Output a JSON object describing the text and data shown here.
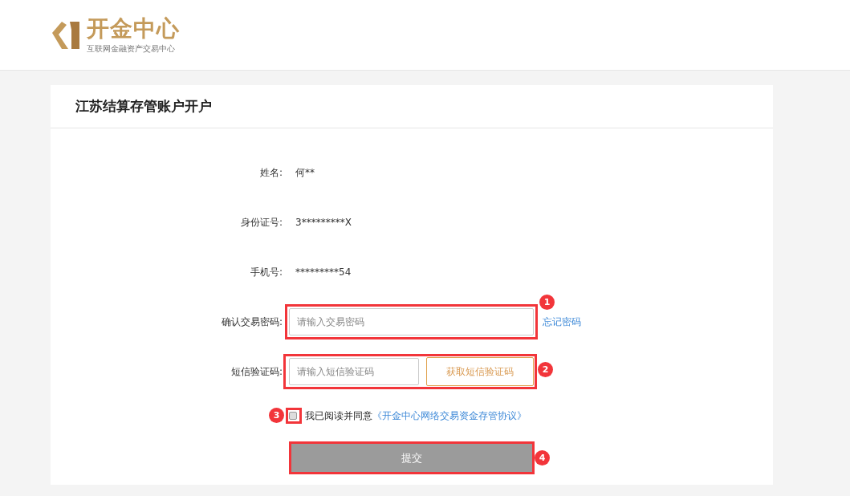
{
  "logo": {
    "name": "开金中心",
    "tagline": "互联网金融资产交易中心"
  },
  "card": {
    "title": "江苏结算存管账户开户"
  },
  "info_rows": [
    {
      "label": "姓名:",
      "value": "何**"
    },
    {
      "label": "身份证号:",
      "value": "3*********X"
    },
    {
      "label": "手机号:",
      "value": "*********54"
    }
  ],
  "password": {
    "label": "确认交易密码:",
    "placeholder": "请输入交易密码",
    "link": "忘记密码",
    "annotation": "1"
  },
  "sms": {
    "label": "短信验证码:",
    "placeholder": "请输入短信验证码",
    "button": "获取短信验证码",
    "annotation": "2"
  },
  "agreement": {
    "checked": false,
    "text": "我已阅读并同意",
    "link": "《开金中心网络交易资金存管协议》",
    "annotation": "3"
  },
  "submit": {
    "label": "提交",
    "disabled": true,
    "annotation": "4"
  }
}
